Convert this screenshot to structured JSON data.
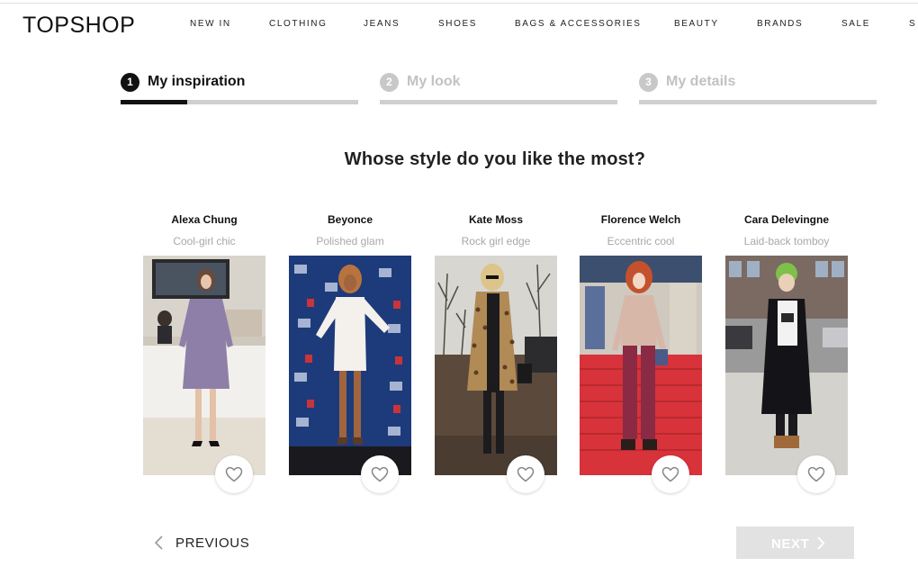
{
  "brand": {
    "logo": "TOPSHOP"
  },
  "nav": {
    "items": [
      {
        "label": "NEW IN"
      },
      {
        "label": "CLOTHING"
      },
      {
        "label": "JEANS"
      },
      {
        "label": "SHOES"
      },
      {
        "label": "BAGS & ACCESSORIES"
      },
      {
        "label": "BEAUTY"
      },
      {
        "label": "BRANDS"
      },
      {
        "label": "SALE"
      },
      {
        "label": "S"
      }
    ]
  },
  "steps": [
    {
      "number": "1",
      "label": "My inspiration",
      "state": "active",
      "progress": 0.28
    },
    {
      "number": "2",
      "label": "My look",
      "state": "inactive",
      "progress": 0
    },
    {
      "number": "3",
      "label": "My details",
      "state": "inactive",
      "progress": 0
    }
  ],
  "question": "Whose style do you like the most?",
  "cards": [
    {
      "name": "Alexa Chung",
      "description": "Cool-girl chic",
      "icon": "heart-outline-icon"
    },
    {
      "name": "Beyonce",
      "description": "Polished glam",
      "icon": "heart-outline-icon"
    },
    {
      "name": "Kate Moss",
      "description": "Rock girl edge",
      "icon": "heart-outline-icon"
    },
    {
      "name": "Florence Welch",
      "description": "Eccentric cool",
      "icon": "heart-outline-icon"
    },
    {
      "name": "Cara Delevingne",
      "description": "Laid-back tomboy",
      "icon": "heart-outline-icon"
    }
  ],
  "pagination": {
    "previous_label": "PREVIOUS",
    "next_label": "NEXT",
    "next_enabled": false
  },
  "colors": {
    "active": "#111111",
    "inactive": "#c8c8c8",
    "next_button_disabled": "#e2e2e2"
  }
}
